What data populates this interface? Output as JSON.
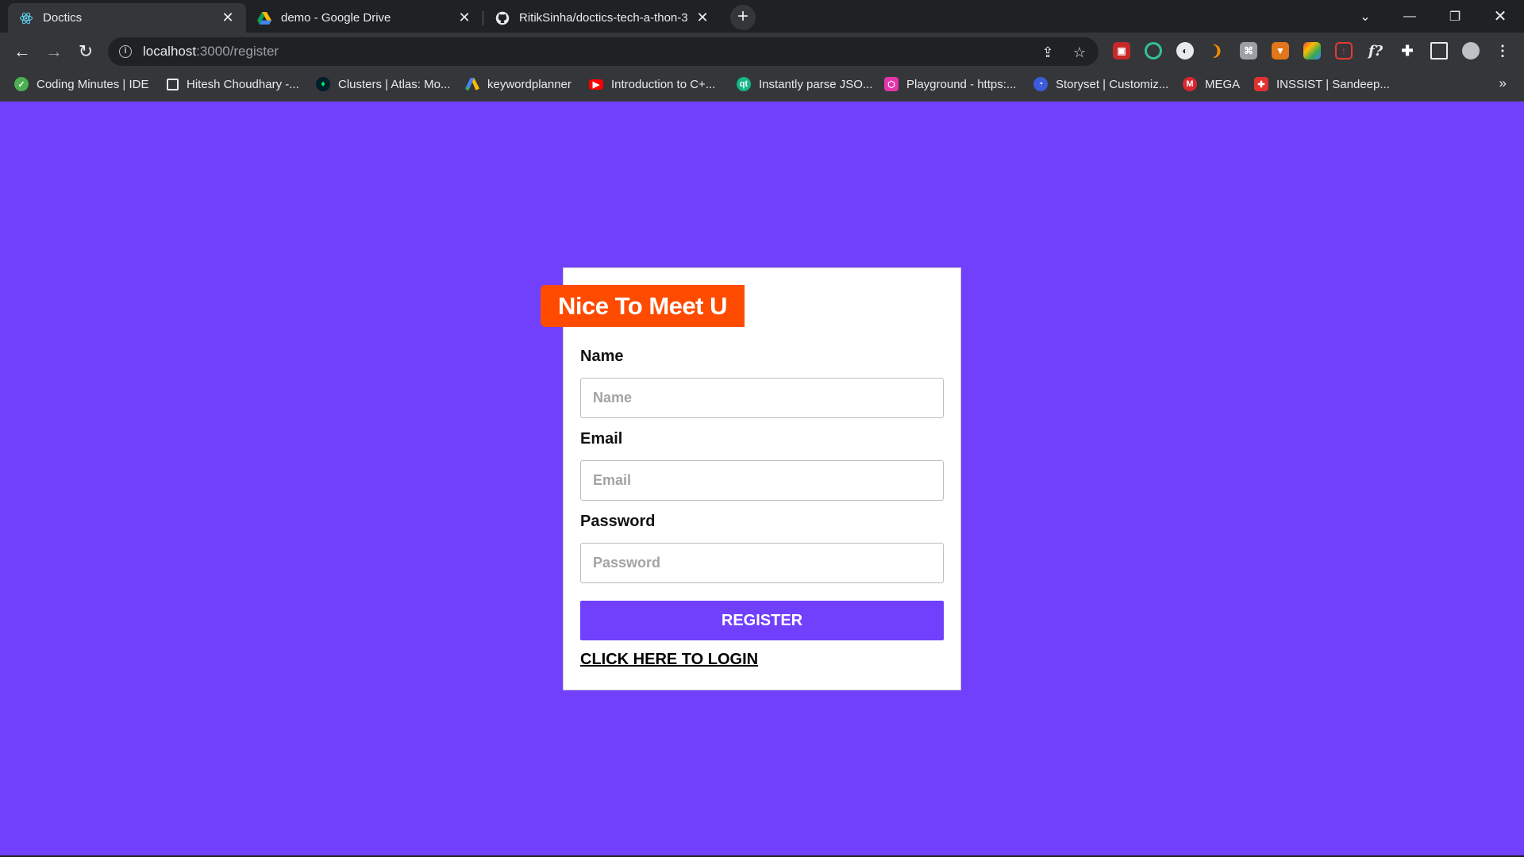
{
  "browser": {
    "tabs": [
      {
        "title": "Doctics",
        "icon": "react-icon",
        "active": true
      },
      {
        "title": "demo - Google Drive",
        "icon": "google-drive-icon",
        "active": false
      },
      {
        "title": "RitikSinha/doctics-tech-a-thon-3",
        "icon": "github-icon",
        "active": false
      }
    ],
    "url_host": "localhost",
    "url_path": ":3000/register",
    "bookmarks": [
      {
        "label": "Coding Minutes | IDE",
        "icon": "check-circle-icon",
        "color": "#4caf50"
      },
      {
        "label": "Hitesh Choudhary -...",
        "icon": "square-icon",
        "color": "#e8eaed"
      },
      {
        "label": "Clusters | Atlas: Mo...",
        "icon": "mongodb-leaf-icon",
        "color": "#00ed64"
      },
      {
        "label": "keywordplanner",
        "icon": "google-ads-icon",
        "color": "#fbbc04"
      },
      {
        "label": "Introduction to C+...",
        "icon": "youtube-icon",
        "color": "#ff0000"
      },
      {
        "label": "Instantly parse JSO...",
        "icon": "quicktype-icon",
        "color": "#12b886"
      },
      {
        "label": "Playground - https:...",
        "icon": "graphql-icon",
        "color": "#e535ab"
      },
      {
        "label": "Storyset | Customiz...",
        "icon": "storyset-icon",
        "color": "#3b5bdb"
      },
      {
        "label": "MEGA",
        "icon": "mega-icon",
        "color": "#d9272e"
      },
      {
        "label": "INSSIST | Sandeep...",
        "icon": "inssist-icon",
        "color": "#e03131"
      }
    ]
  },
  "page": {
    "banner": "Nice To Meet U",
    "name_label": "Name",
    "name_placeholder": "Name",
    "email_label": "Email",
    "email_placeholder": "Email",
    "password_label": "Password",
    "password_placeholder": "Password",
    "register_button": "REGISTER",
    "login_link": "CLICK HERE TO LOGIN"
  },
  "colors": {
    "background": "#7140fd",
    "banner": "#fe4b00",
    "button": "#7140fd"
  }
}
